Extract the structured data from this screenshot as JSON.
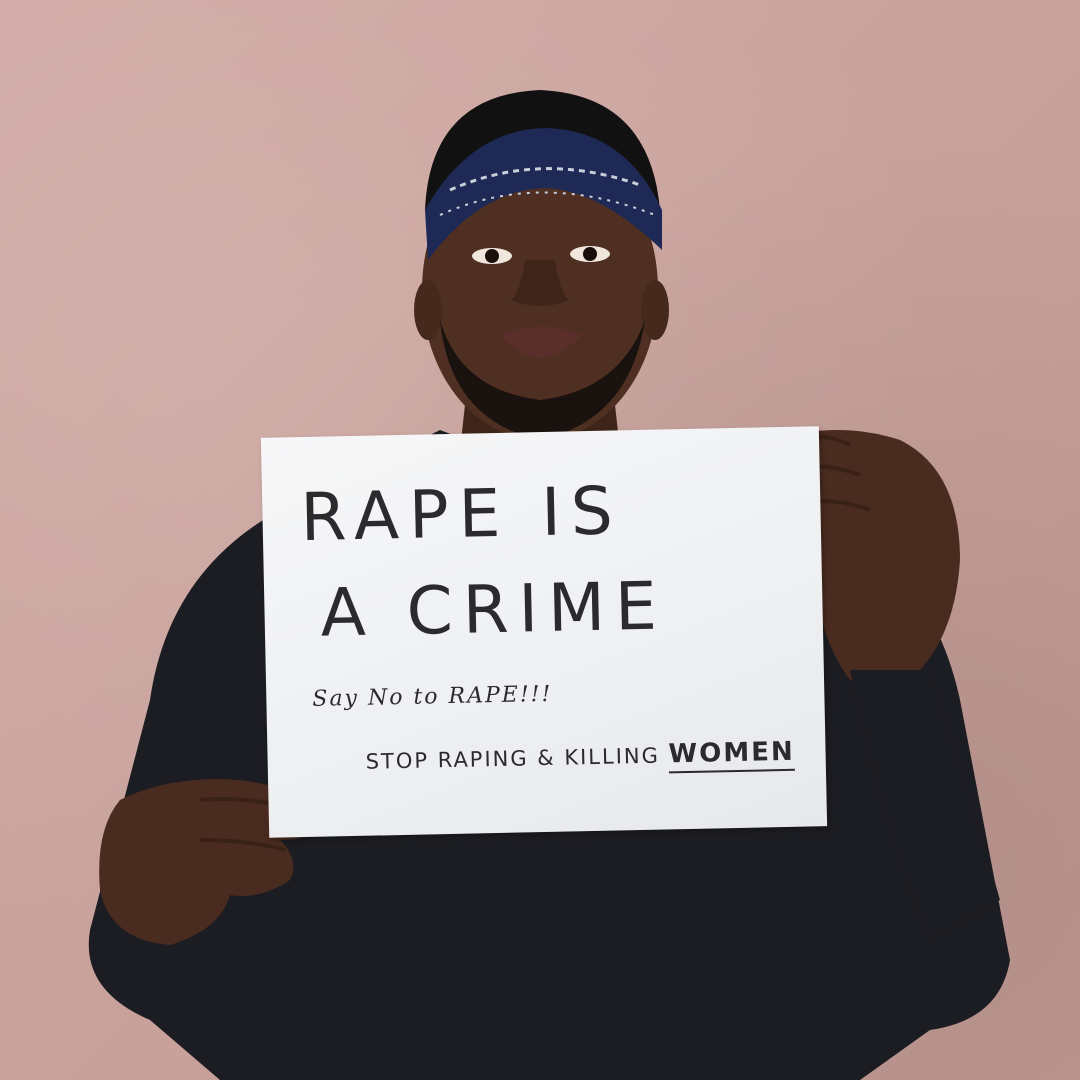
{
  "sign": {
    "line1": "RAPE IS",
    "line2": "A CRIME",
    "line3": "Say No to RAPE!!!",
    "line4_prefix": "STOP RAPING & KILLING ",
    "line4_emphasis": "WOMEN"
  },
  "colors": {
    "wall": "#c9a29c",
    "sweater": "#1c1d22",
    "skin": "#4e2f22",
    "bandana": "#1e2a55",
    "paper": "#f2f3f5",
    "ink": "#2b2b2e"
  }
}
